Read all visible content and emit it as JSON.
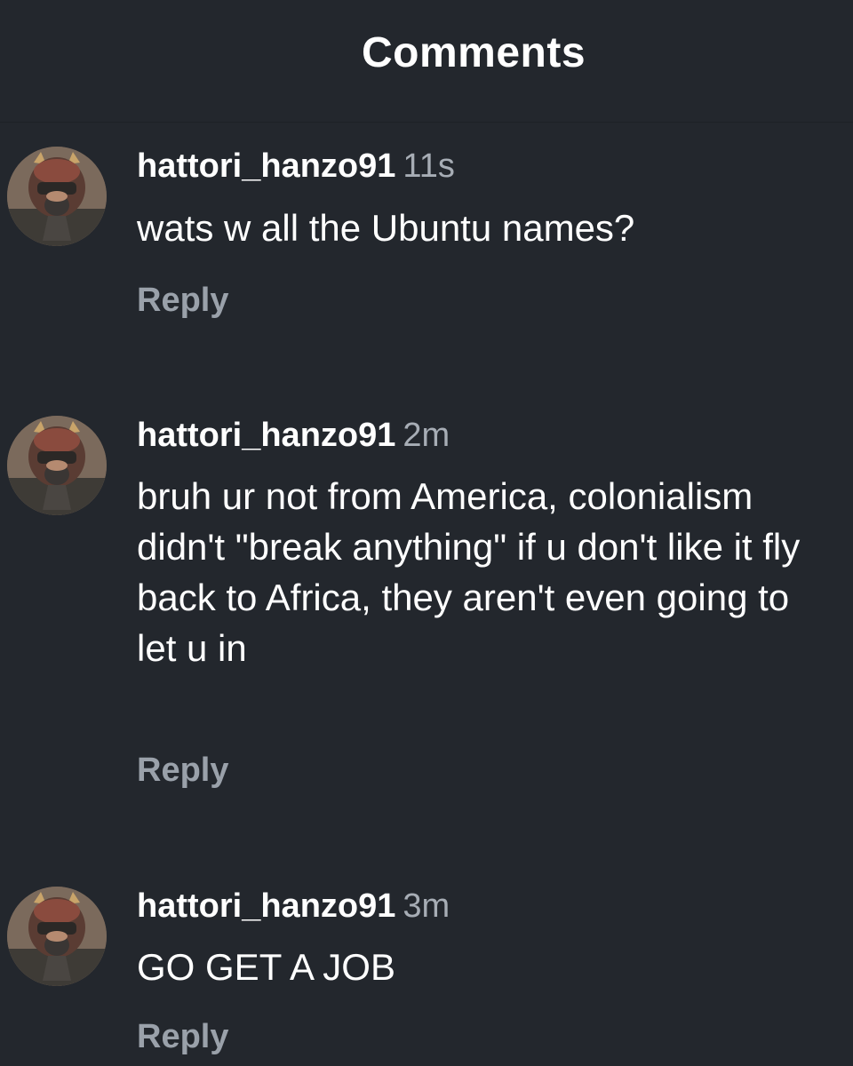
{
  "header": {
    "title": "Comments"
  },
  "comments": [
    {
      "username": "hattori_hanzo91",
      "time": "11s",
      "text": "wats w all the Ubuntu names?",
      "reply_label": "Reply",
      "avatar_icon": "pilot-helmet-avatar"
    },
    {
      "username": "hattori_hanzo91",
      "time": "2m",
      "text": "bruh ur not from America, colonialism didn't \"break anything\" if u don't like it fly back to Africa, they aren't even going to let u in",
      "reply_label": "Reply",
      "avatar_icon": "pilot-helmet-avatar"
    },
    {
      "username": "hattori_hanzo91",
      "time": "3m",
      "text": "GO GET A JOB",
      "reply_label": "Reply",
      "avatar_icon": "pilot-helmet-avatar"
    }
  ],
  "colors": {
    "background": "#23272d",
    "text": "#ffffff",
    "timestamp": "#a7adb5",
    "reply": "#9aa1aa"
  }
}
